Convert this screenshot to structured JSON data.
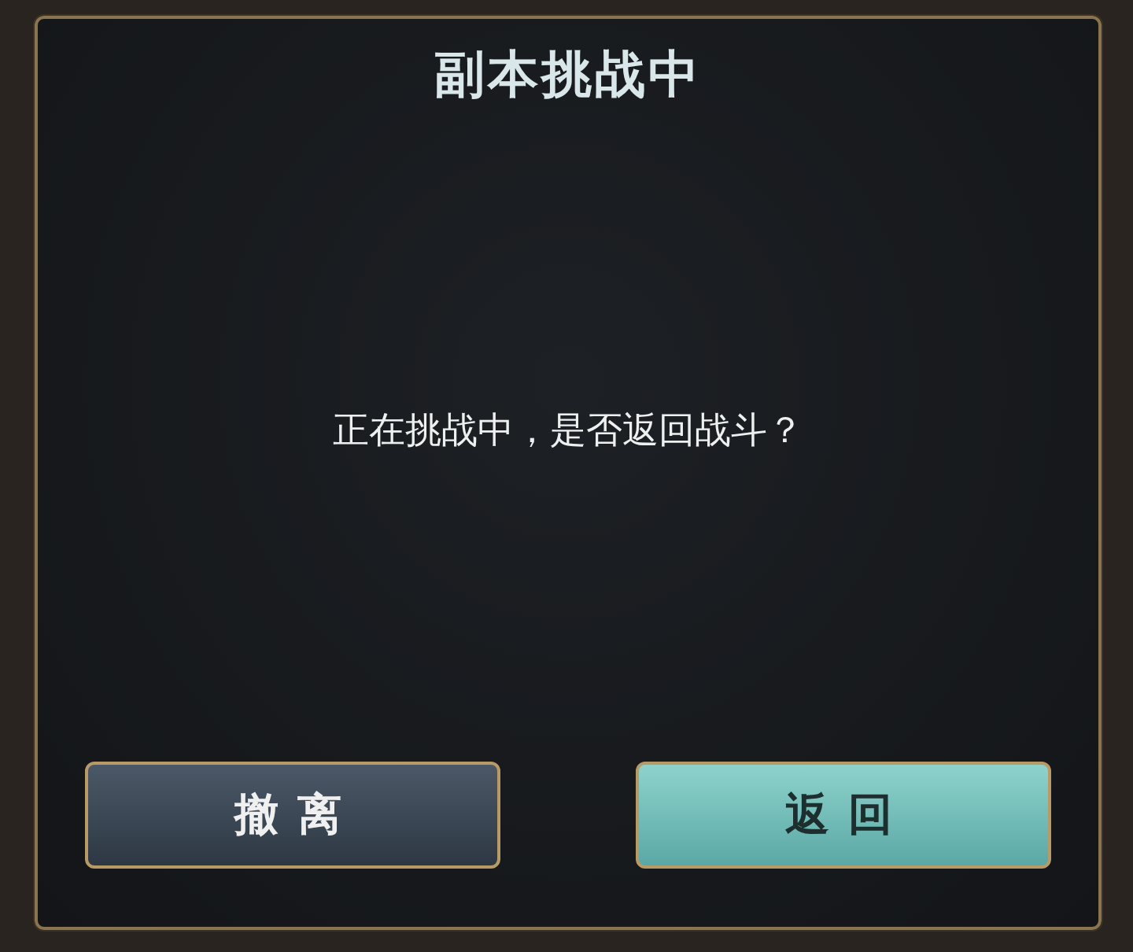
{
  "dialog": {
    "title": "副本挑战中",
    "message": "正在挑战中，是否返回战斗？",
    "buttons": [
      {
        "label": "撤离",
        "kind": "secondary"
      },
      {
        "label": "返回",
        "kind": "primary"
      }
    ]
  }
}
